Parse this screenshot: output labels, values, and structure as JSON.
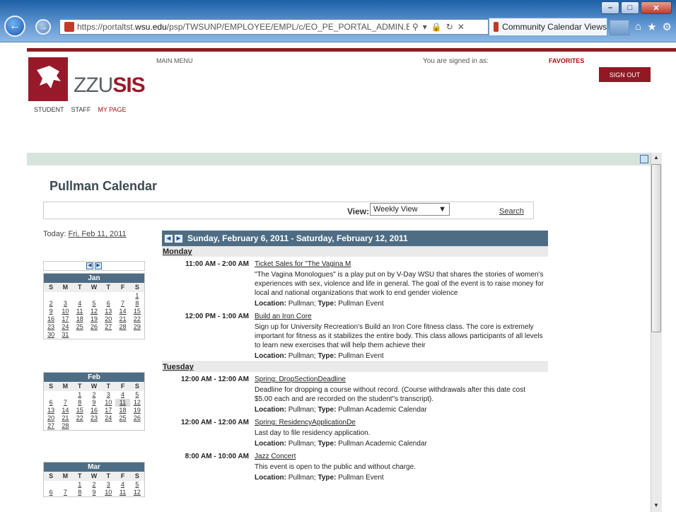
{
  "browser": {
    "url_prefix": "https://portaltst.",
    "url_domain": "wsu.edu",
    "url_path": "/psp/TWSUNP/EMPLOYEE/EMPL/c/EO_PE_PORTAL_ADMIN.EPPCA_C",
    "tab_title": "Community Calendar Views",
    "window_buttons": [
      "–",
      "□",
      "✕"
    ],
    "tools": [
      "⌂",
      "★",
      "⚙"
    ]
  },
  "header": {
    "logo_thin": "ZZU",
    "logo_bold": "SIS",
    "main_menu": "MAIN MENU",
    "signed_in": "You are signed in as:",
    "favorites": "FAVORITES",
    "sign_out": "SIGN OUT",
    "tabs": [
      "STUDENT",
      "STAFF",
      "MY PAGE"
    ]
  },
  "page": {
    "title": "Pullman Calendar",
    "view_label": "View:",
    "view_value": "Weekly View",
    "search": "Search",
    "today_label": "Today:",
    "today_value": "Fri, Feb 11, 2011"
  },
  "dow": [
    "S",
    "M",
    "T",
    "W",
    "T",
    "F",
    "S"
  ],
  "minicals": [
    {
      "month": "Jan",
      "days": [
        "",
        "",
        "",
        "",
        "",
        "",
        "1",
        "2",
        "3",
        "4",
        "5",
        "6",
        "7",
        "8",
        "9",
        "10",
        "11",
        "12",
        "13",
        "14",
        "15",
        "16",
        "17",
        "18",
        "19",
        "20",
        "21",
        "22",
        "23",
        "24",
        "25",
        "26",
        "27",
        "28",
        "29",
        "30",
        "31"
      ]
    },
    {
      "month": "Feb",
      "days": [
        "",
        "",
        "1",
        "2",
        "3",
        "4",
        "5",
        "6",
        "7",
        "8",
        "9",
        "10",
        "11",
        "12",
        "13",
        "14",
        "15",
        "16",
        "17",
        "18",
        "19",
        "20",
        "21",
        "22",
        "23",
        "24",
        "25",
        "26",
        "27",
        "28"
      ]
    },
    {
      "month": "Mar",
      "days": [
        "",
        "",
        "1",
        "2",
        "3",
        "4",
        "5",
        "6",
        "7",
        "8",
        "9",
        "10",
        "11",
        "12"
      ]
    }
  ],
  "week": {
    "range": "Sunday, February 6, 2011 - Saturday, February 12, 2011",
    "days": [
      {
        "name": "Monday",
        "events": [
          {
            "time": "11:00 AM - 2:00 AM",
            "title": "Ticket Sales for \"The Vagina M",
            "desc": "\"The Vagina Monologues\" is a play put on by V-Day WSU that shares the stories of women's experiences with sex, violence and life in general. The goal of the event is to raise money for local and national organizations that work to end gender violence",
            "location": "Pullman",
            "type": "Pullman Event"
          },
          {
            "time": "12:00 PM - 1:00 AM",
            "title": "Build an Iron Core",
            "desc": "Sign up for University Recreation's Build an Iron Core fitness class. The core is extremely important for fitness as it stabilizes the entire body. This class allows participants of all levels to learn new exercises that will help them achieve their",
            "location": "Pullman",
            "type": "Pullman Event"
          }
        ]
      },
      {
        "name": "Tuesday",
        "events": [
          {
            "time": "12:00 AM - 12:00 AM",
            "title": "Spring: DropSectionDeadline",
            "desc": "Deadline for dropping a course without record. (Course withdrawals after this date cost $5.00 each and are recorded on the student\"s transcript).",
            "location": "Pullman",
            "type": "Pullman Academic Calendar"
          },
          {
            "time": "12:00 AM - 12:00 AM",
            "title": "Spring: ResidencyApplicationDe",
            "desc": "Last day to file residency application.",
            "location": "Pullman",
            "type": "Pullman Academic Calendar"
          },
          {
            "time": "8:00 AM - 10:00 AM",
            "title": "Jazz Concert",
            "desc": "This event is open to the public and without charge.",
            "location": "Pullman",
            "type": "Pullman Event"
          }
        ]
      }
    ]
  },
  "labels": {
    "location": "Location:",
    "type": "Type:"
  }
}
